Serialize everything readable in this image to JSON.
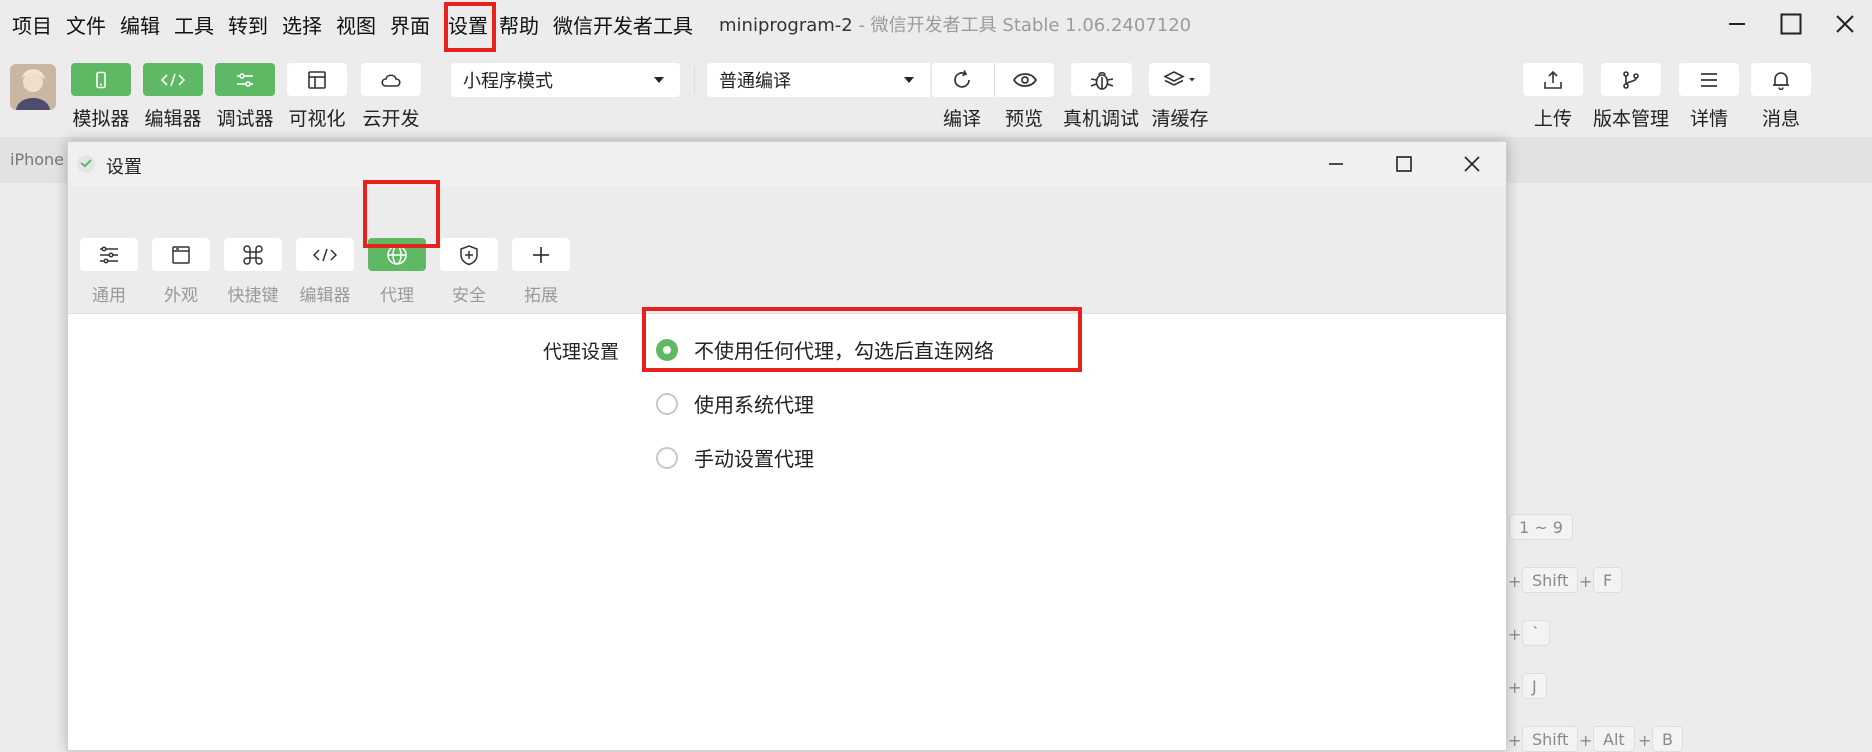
{
  "menubar": {
    "items": [
      "项目",
      "文件",
      "编辑",
      "工具",
      "转到",
      "选择",
      "视图",
      "界面",
      "设置",
      "帮助",
      "微信开发者工具"
    ],
    "project": "miniprogram-2",
    "app_title": "- 微信开发者工具 Stable 1.06.2407120"
  },
  "toolbar": {
    "left_buttons": [
      {
        "label": "模拟器",
        "icon": "phone-icon"
      },
      {
        "label": "编辑器",
        "icon": "code-icon"
      },
      {
        "label": "调试器",
        "icon": "sliders-icon"
      },
      {
        "label": "可视化",
        "icon": "layout-icon"
      },
      {
        "label": "云开发",
        "icon": "cloud-icon"
      }
    ],
    "mode_select": "小程序模式",
    "compile_select": "普通编译",
    "center_buttons": [
      {
        "label": "编译",
        "icon": "refresh-icon"
      },
      {
        "label": "预览",
        "icon": "eye-icon"
      },
      {
        "label": "真机调试",
        "icon": "bug-icon"
      },
      {
        "label": "清缓存",
        "icon": "layers-icon"
      }
    ],
    "right_buttons": [
      {
        "label": "上传",
        "icon": "upload-icon"
      },
      {
        "label": "版本管理",
        "icon": "branch-icon"
      },
      {
        "label": "详情",
        "icon": "menu-icon"
      },
      {
        "label": "消息",
        "icon": "bell-icon"
      }
    ]
  },
  "simulator": {
    "device_label": "iPhone"
  },
  "shortcut_hints": {
    "row1": [
      "1 ~ 9"
    ],
    "row2": [
      "Shift",
      "F"
    ],
    "row3": [
      "`"
    ],
    "row4": [
      "J"
    ],
    "row5": [
      "Shift",
      "Alt",
      "B"
    ],
    "plus": "+"
  },
  "dialog": {
    "title": "设置",
    "tabs": [
      {
        "label": "通用",
        "icon": "sliders-icon"
      },
      {
        "label": "外观",
        "icon": "window-icon"
      },
      {
        "label": "快捷键",
        "icon": "command-icon"
      },
      {
        "label": "编辑器",
        "icon": "code-icon"
      },
      {
        "label": "代理",
        "icon": "globe-icon",
        "active": true
      },
      {
        "label": "安全",
        "icon": "shield-icon"
      },
      {
        "label": "拓展",
        "icon": "plus-icon"
      }
    ],
    "proxy": {
      "section_title": "代理设置",
      "options": [
        {
          "label": "不使用任何代理，勾选后直连网络",
          "checked": true
        },
        {
          "label": "使用系统代理",
          "checked": false
        },
        {
          "label": "手动设置代理",
          "checked": false
        }
      ]
    }
  },
  "colors": {
    "accent_green": "#5fb864",
    "highlight_red": "#e5221c"
  }
}
